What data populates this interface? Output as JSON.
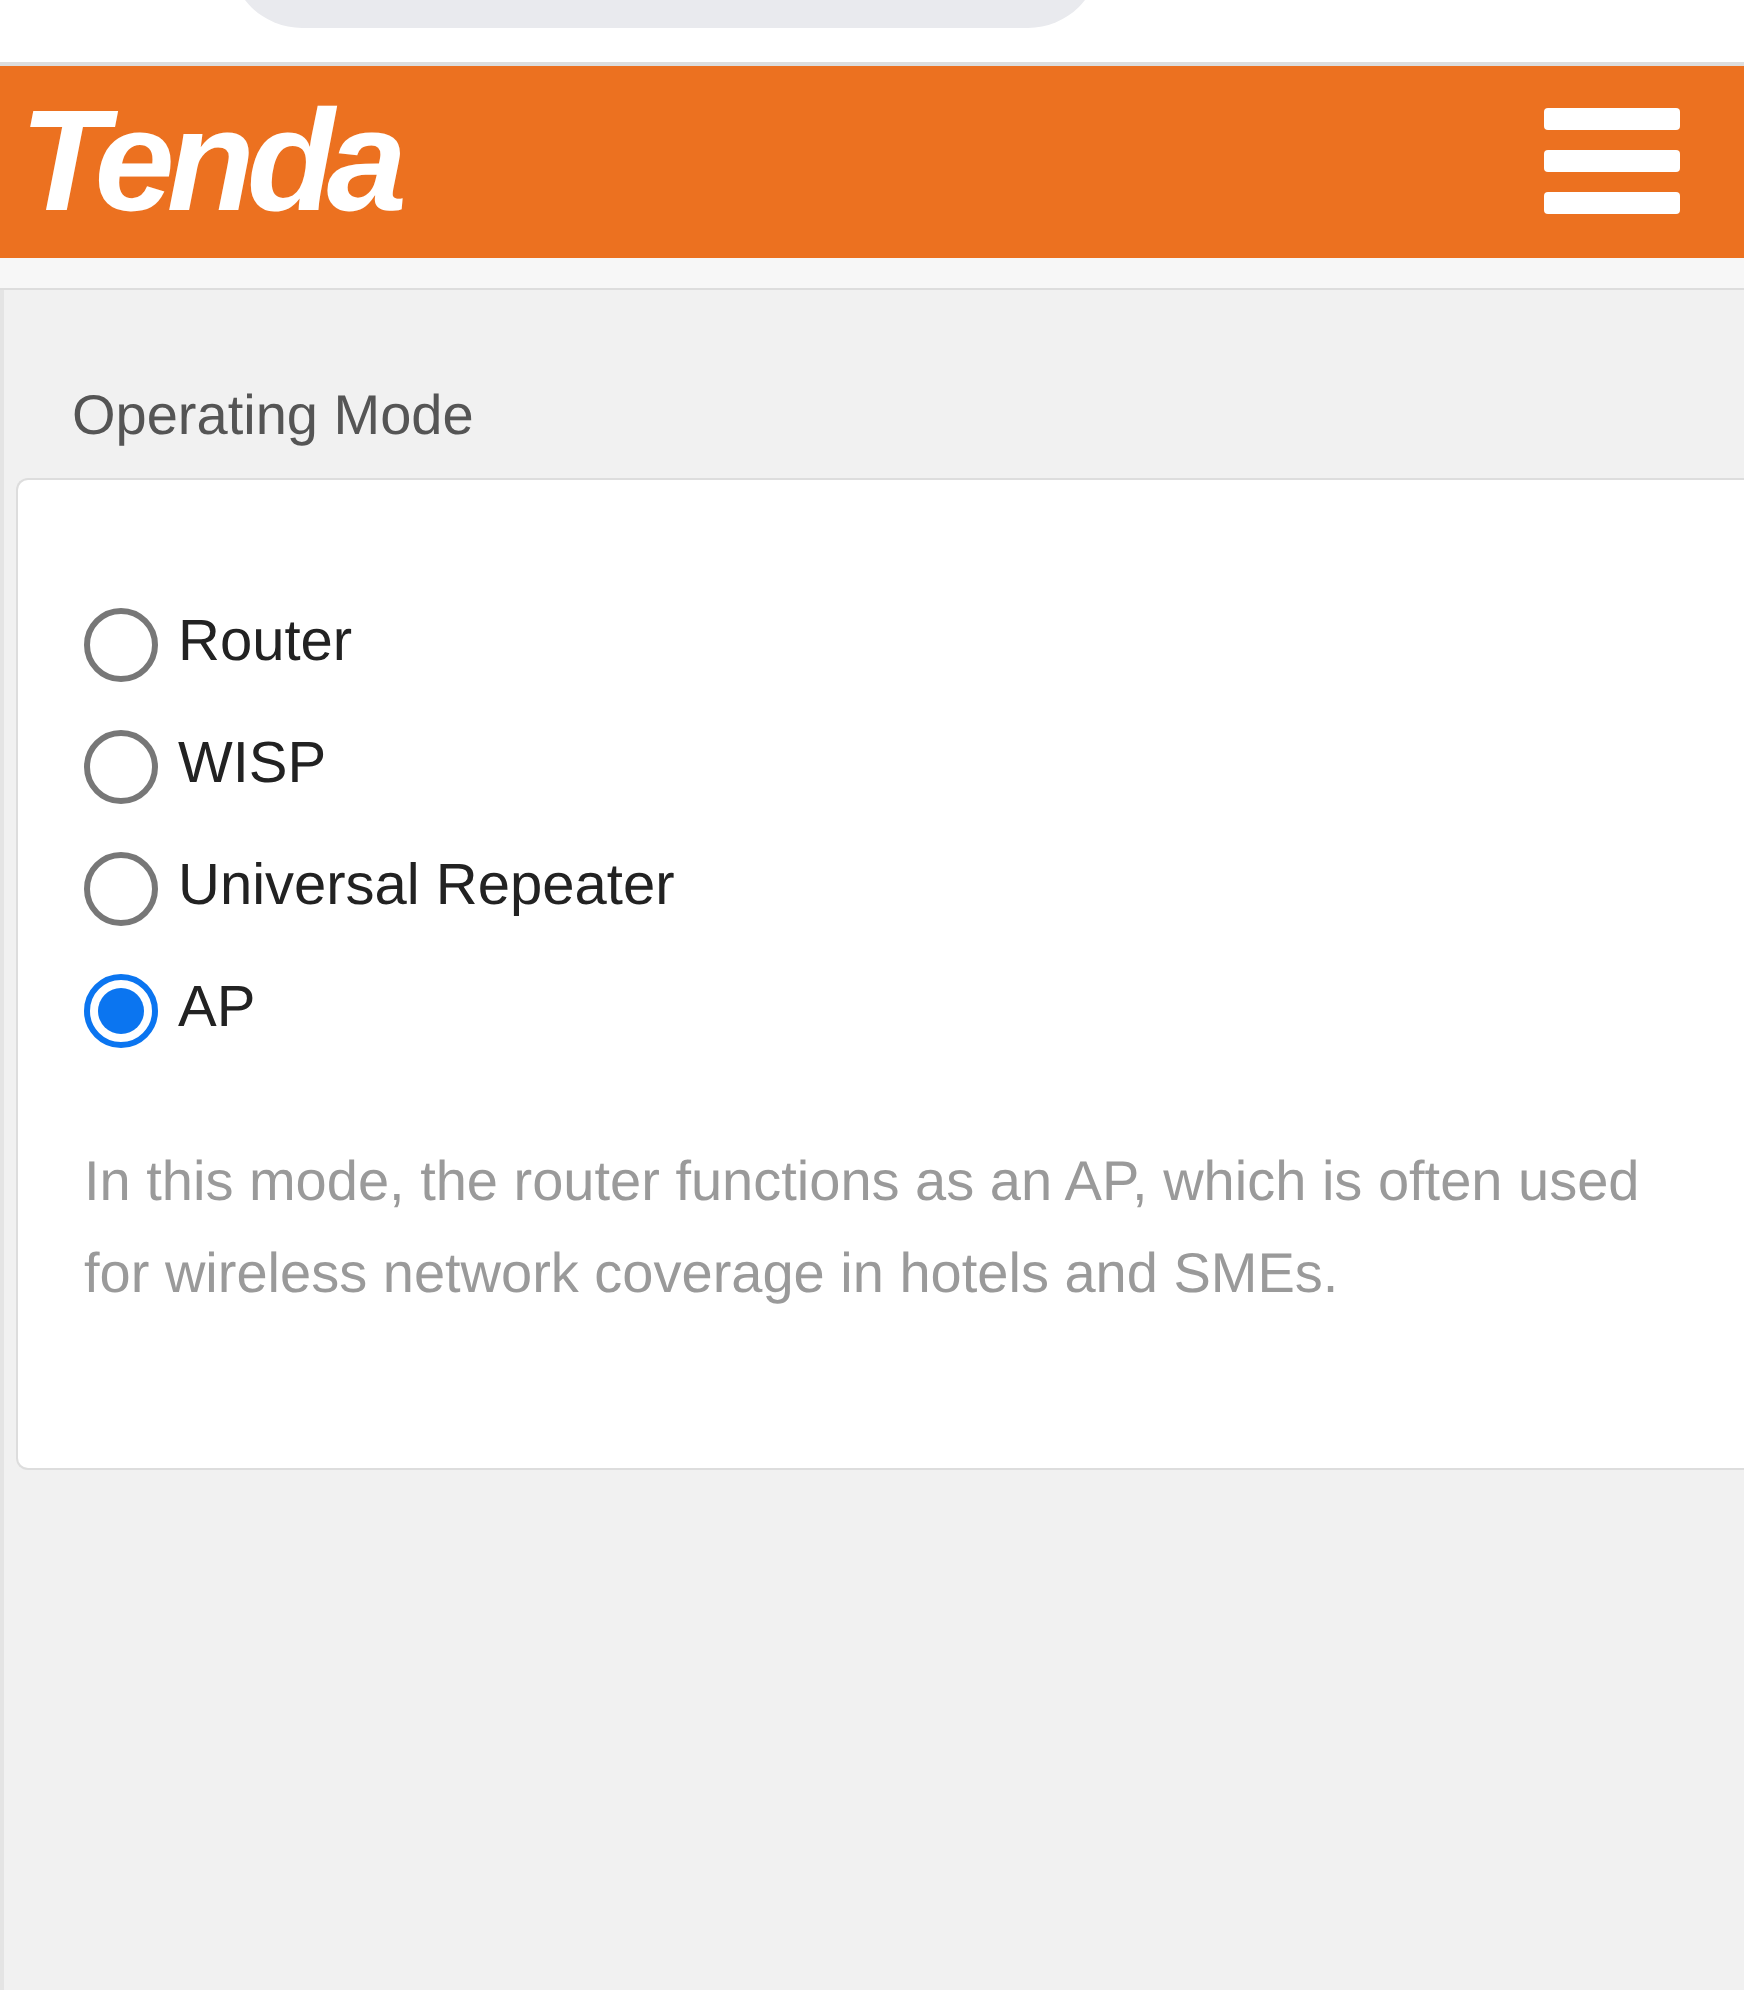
{
  "header": {
    "logo": "Tenda"
  },
  "section": {
    "title": "Operating Mode"
  },
  "modes": [
    {
      "label": "Router",
      "selected": false
    },
    {
      "label": "WISP",
      "selected": false
    },
    {
      "label": "Universal Repeater",
      "selected": false
    },
    {
      "label": "AP",
      "selected": true
    }
  ],
  "description": "In this mode, the router functions as an AP, which is often used for wireless network coverage in hotels and SMEs."
}
